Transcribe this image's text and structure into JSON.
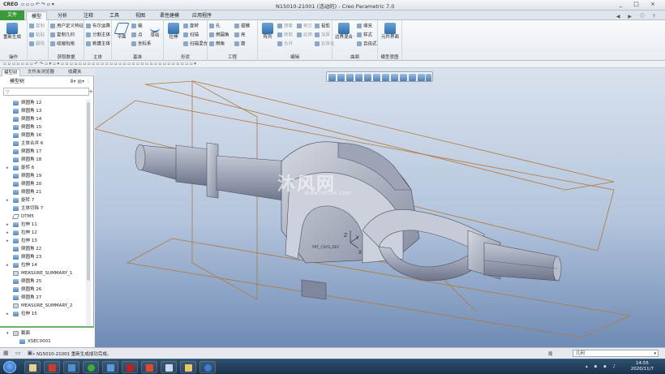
{
  "titlebar": {
    "logo": "CREO",
    "title": "N15010-21001 (活动的) - Creo Parametric 7.0",
    "window_buttons": "_ □ ×"
  },
  "tabs": [
    "文件",
    "模型",
    "分析",
    "注释",
    "工具",
    "视图",
    "柔性建模",
    "应用程序"
  ],
  "ribbon": {
    "groups": [
      {
        "label": "操作",
        "buttons": [
          "重新生成",
          "复制",
          "粘贴",
          "删除"
        ]
      },
      {
        "label": "获取数据",
        "buttons": [
          "用户定义特征",
          "复制几何",
          "收缩包络"
        ]
      },
      {
        "label": "主体",
        "buttons": [
          "布尔运算",
          "分割主体",
          "新建主体"
        ]
      },
      {
        "label": "基准",
        "buttons": [
          "平面",
          "轴",
          "点",
          "坐标系",
          "草绘"
        ]
      },
      {
        "label": "形状",
        "buttons": [
          "拉伸",
          "旋转",
          "扫描",
          "扫描混合"
        ]
      },
      {
        "label": "工程",
        "buttons": [
          "孔",
          "倒圆角",
          "倒角",
          "拔模",
          "壳",
          "筋"
        ]
      },
      {
        "label": "编辑",
        "buttons": [
          "阵列",
          "镜像",
          "修剪",
          "合并",
          "相交",
          "延伸",
          "投影",
          "加厚",
          "实体化"
        ]
      },
      {
        "label": "曲面",
        "buttons": [
          "边界混合",
          "填充",
          "样式",
          "自由式"
        ]
      },
      {
        "label": "模型意图",
        "buttons": [
          "元件界面"
        ]
      }
    ]
  },
  "panel": {
    "tabs": [
      "模型树",
      "文件夹浏览器",
      "收藏夹"
    ],
    "header": "模型树",
    "filter_placeholder": "",
    "tree": [
      {
        "label": "倒圆角 12",
        "icon": "round",
        "expand": ""
      },
      {
        "label": "倒圆角 13",
        "icon": "round",
        "expand": ""
      },
      {
        "label": "倒圆角 14",
        "icon": "round",
        "expand": ""
      },
      {
        "label": "倒圆角 15",
        "icon": "round",
        "expand": ""
      },
      {
        "label": "倒圆角 16",
        "icon": "round",
        "expand": ""
      },
      {
        "label": "主体合并 6",
        "icon": "merge",
        "expand": ""
      },
      {
        "label": "倒圆角 17",
        "icon": "round",
        "expand": ""
      },
      {
        "label": "倒圆角 18",
        "icon": "round",
        "expand": ""
      },
      {
        "label": "旋转 6",
        "icon": "revolve",
        "expand": "▸"
      },
      {
        "label": "倒圆角 19",
        "icon": "round",
        "expand": ""
      },
      {
        "label": "倒圆角 20",
        "icon": "round",
        "expand": ""
      },
      {
        "label": "倒圆角 21",
        "icon": "round",
        "expand": ""
      },
      {
        "label": "旋转 7",
        "icon": "revolve",
        "expand": "▸"
      },
      {
        "label": "主体切除 7",
        "icon": "cut",
        "expand": ""
      },
      {
        "label": "DTM5",
        "icon": "datum",
        "expand": ""
      },
      {
        "label": "拉伸 11",
        "icon": "extrude",
        "expand": "▸"
      },
      {
        "label": "拉伸 12",
        "icon": "extrude",
        "expand": "▸"
      },
      {
        "label": "拉伸 13",
        "icon": "extrude",
        "expand": "▸"
      },
      {
        "label": "倒圆角 22",
        "icon": "round",
        "expand": ""
      },
      {
        "label": "倒圆角 23",
        "icon": "round",
        "expand": ""
      },
      {
        "label": "拉伸 14",
        "icon": "extrude",
        "expand": "▸"
      },
      {
        "label": "MEASURE_SUMMARY_1",
        "icon": "measure",
        "expand": ""
      },
      {
        "label": "倒圆角 25",
        "icon": "round",
        "expand": ""
      },
      {
        "label": "倒圆角 26",
        "icon": "round",
        "expand": ""
      },
      {
        "label": "倒圆角 27",
        "icon": "round",
        "expand": ""
      },
      {
        "label": "MEASURE_SUMMARY_2",
        "icon": "measure",
        "expand": ""
      },
      {
        "label": "拉伸 15",
        "icon": "extrude",
        "expand": "▸"
      }
    ],
    "lower_tree": [
      {
        "label": "截面",
        "expand": "▾"
      },
      {
        "label": "XSEC0001",
        "expand": ""
      }
    ]
  },
  "viewport": {
    "watermark": "沐风网",
    "watermark_url": "www.mfcad.com",
    "axis_labels": [
      "Z",
      "Y",
      "X"
    ],
    "csys_label": "PRT_CSYS_DEF"
  },
  "statusbar": {
    "message": "• N15010-21001 重新生成成功完成。",
    "selection_filter": "几何",
    "icon_label": "局"
  },
  "taskbar": {
    "time": "14:55",
    "date": "2020/11/7"
  }
}
